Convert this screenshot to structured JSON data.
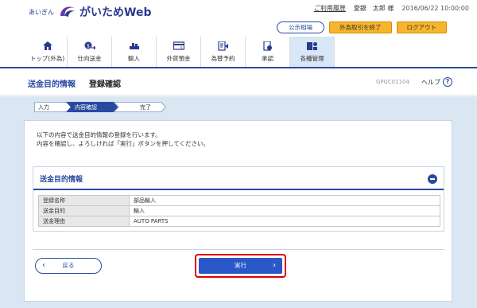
{
  "header": {
    "logo_small": "あいぎん",
    "logo_main": "がいためWeb",
    "usage_history": "ご利用履歴",
    "user_name": "愛銀　太郎 様",
    "datetime": "2016/06/22 10:00:00",
    "public_rates": "公示相場",
    "end_fx": "外為取引を終了",
    "logout": "ログアウト"
  },
  "nav": [
    {
      "label": "トップ(外為)",
      "icon": "home-icon"
    },
    {
      "label": "仕向送金",
      "icon": "remittance-icon"
    },
    {
      "label": "輸入",
      "icon": "import-icon"
    },
    {
      "label": "外貨預金",
      "icon": "deposit-icon"
    },
    {
      "label": "為替予約",
      "icon": "contract-icon"
    },
    {
      "label": "承認",
      "icon": "approval-icon"
    },
    {
      "label": "各種管理",
      "icon": "management-icon"
    }
  ],
  "title": {
    "main": "送金目的情報",
    "sub": "登録確認",
    "screen_id": "GPUC01104",
    "help": "ヘルプ"
  },
  "steps": [
    "入力",
    "内容確認",
    "完了"
  ],
  "intro": {
    "line1": "以下の内容で送金目的情報の登録を行います。",
    "line2": "内容を確認し、よろしければ「実行」ボタンを押してください。"
  },
  "section": {
    "title": "送金目的情報",
    "rows": [
      {
        "label": "登録名称",
        "value": "部品輸入"
      },
      {
        "label": "送金目的",
        "value": "輸入"
      },
      {
        "label": "送金理由",
        "value": "AUTO PARTS"
      }
    ]
  },
  "buttons": {
    "back": "戻る",
    "execute": "実行"
  },
  "colors": {
    "primary": "#2a4aa0",
    "accent_orange": "#f6b52b",
    "highlight_red": "#e00000",
    "background": "#dbe6f3"
  }
}
